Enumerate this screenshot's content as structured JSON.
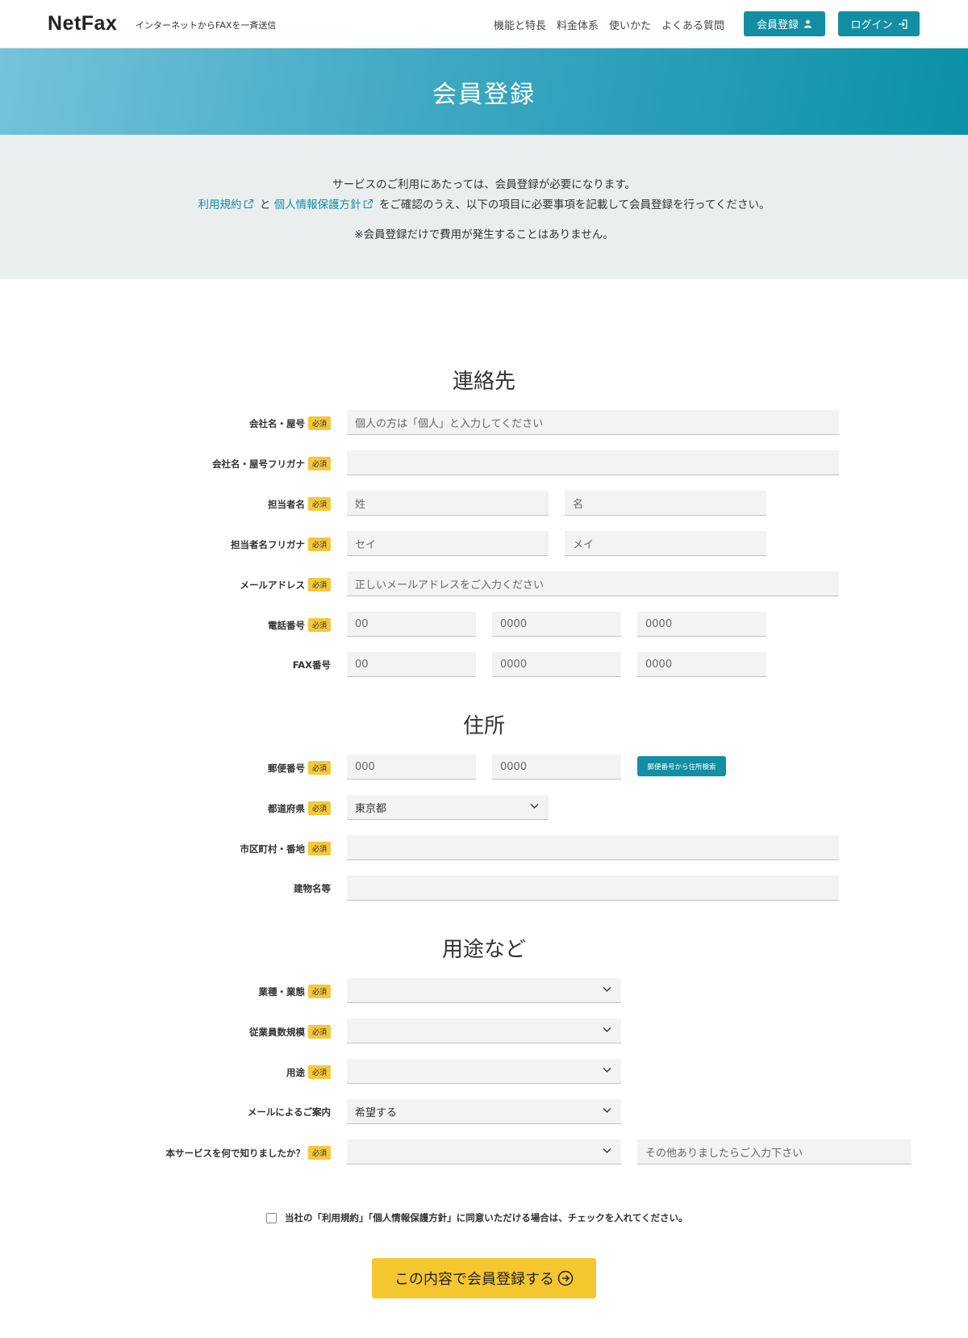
{
  "header": {
    "logo": "NetFax",
    "tagline": "インターネットからFAXを一斉送信",
    "nav": [
      "機能と特長",
      "料金体系",
      "使いかた",
      "よくある質問"
    ],
    "register_button": "会員登録",
    "login_button": "ログイン"
  },
  "hero": {
    "title": "会員登録"
  },
  "intro": {
    "line1": "サービスのご利用にあたっては、会員登録が必要になります。",
    "terms_link": "利用規約",
    "conj": "と",
    "privacy_link": "個人情報保護方針",
    "line2_rest": "をご確認のうえ、以下の項目に必要事項を記載して会員登録を行ってください。",
    "line3": "※会員登録だけで費用が発生することはありません。"
  },
  "required_badge": "必須",
  "contact": {
    "title": "連絡先",
    "company_label": "会社名・屋号",
    "company_placeholder": "個人の方は「個人」と入力してください",
    "company_kana_label": "会社名・屋号フリガナ",
    "person_label": "担当者名",
    "last_name_placeholder": "姓",
    "first_name_placeholder": "名",
    "person_kana_label": "担当者名フリガナ",
    "last_kana_placeholder": "セイ",
    "first_kana_placeholder": "メイ",
    "email_label": "メールアドレス",
    "email_placeholder": "正しいメールアドレスをご入力ください",
    "phone_label": "電話番号",
    "phone_placeholders": [
      "00",
      "0000",
      "0000"
    ],
    "fax_label": "FAX番号",
    "fax_placeholders": [
      "00",
      "0000",
      "0000"
    ]
  },
  "address": {
    "title": "住所",
    "zip_label": "郵便番号",
    "zip_placeholders": [
      "000",
      "0000"
    ],
    "zip_search_button": "郵便番号から住所検索",
    "pref_label": "都道府県",
    "pref_value": "東京都",
    "city_label": "市区町村・番地",
    "building_label": "建物名等"
  },
  "usage": {
    "title": "用途など",
    "industry_label": "業種・業態",
    "employees_label": "従業員数規模",
    "purpose_label": "用途",
    "mail_label": "メールによるご案内",
    "mail_value": "希望する",
    "source_label": "本サービスを何で知りましたか？",
    "other_placeholder": "その他ありましたらご入力下さい"
  },
  "agreement": "当社の「利用規約」「個人情報保護方針」に同意いただける場合は、チェックを入れてください。",
  "submit_button": "この内容で会員登録する"
}
